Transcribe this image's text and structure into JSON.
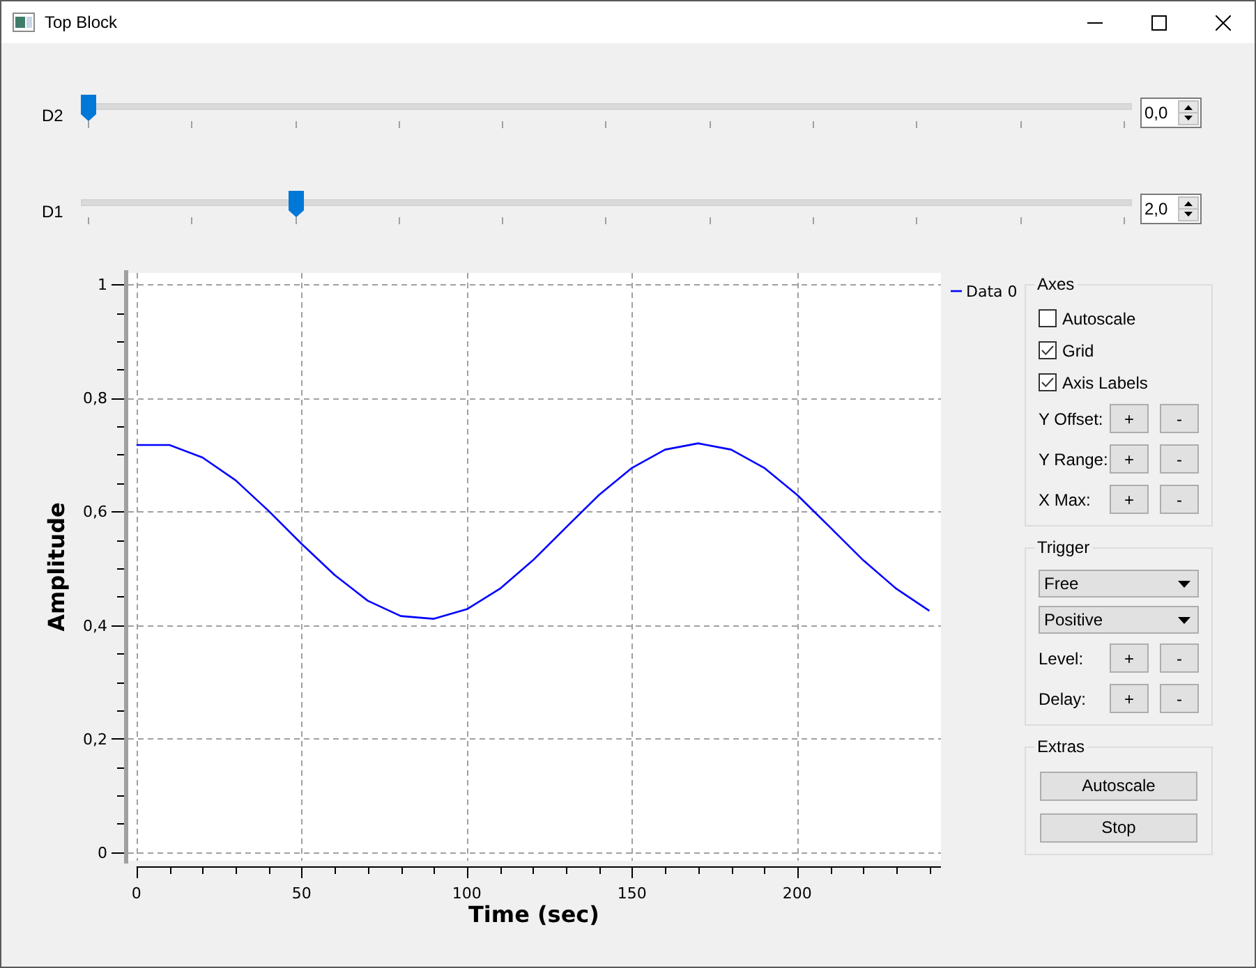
{
  "window": {
    "title": "Top Block"
  },
  "sliders": [
    {
      "label": "D2",
      "level": 0,
      "value": "0,0"
    },
    {
      "label": "D1",
      "level": 0.2,
      "value": "2,0"
    }
  ],
  "plot": {
    "chart_data": {
      "type": "line",
      "xlabel": "Time (sec)",
      "ylabel": "Amplitude",
      "x": [
        0,
        10,
        20,
        30,
        40,
        50,
        60,
        70,
        80,
        90,
        100,
        110,
        120,
        130,
        140,
        150,
        160,
        170,
        180,
        190,
        200,
        210,
        220,
        230,
        240
      ],
      "series": [
        {
          "name": "Data 0",
          "color": "#0000ff",
          "values": [
            0.717,
            0.717,
            0.695,
            0.655,
            0.601,
            0.543,
            0.488,
            0.443,
            0.416,
            0.411,
            0.428,
            0.464,
            0.514,
            0.572,
            0.629,
            0.677,
            0.709,
            0.72,
            0.709,
            0.677,
            0.629,
            0.572,
            0.514,
            0.464,
            0.425
          ]
        }
      ],
      "grid": true,
      "xlim": [
        -2.5,
        243.5
      ],
      "ylim": [
        -0.015,
        1.02
      ],
      "xticks": [
        0,
        50,
        100,
        150,
        200
      ],
      "yticks": [
        {
          "value": 0,
          "label": "0"
        },
        {
          "value": 0.2,
          "label": "0,2"
        },
        {
          "value": 0.4,
          "label": "0,4"
        },
        {
          "value": 0.6,
          "label": "0,6"
        },
        {
          "value": 0.8,
          "label": "0,8"
        },
        {
          "value": 1,
          "label": "1"
        }
      ]
    }
  },
  "groups": [
    {
      "title": "Axes",
      "rows": [
        {
          "kind": "checkbox",
          "label": "Autoscale",
          "checked": false
        },
        {
          "kind": "checkbox",
          "label": "Grid",
          "checked": true
        },
        {
          "kind": "checkbox",
          "label": "Axis Labels",
          "checked": true
        },
        {
          "kind": "stepper",
          "label": "Y Offset:",
          "buttons": [
            "+",
            "-"
          ]
        },
        {
          "kind": "stepper",
          "label": "Y Range:",
          "buttons": [
            "+",
            "-"
          ]
        },
        {
          "kind": "stepper",
          "label": "X Max:",
          "buttons": [
            "+",
            "-"
          ]
        }
      ]
    },
    {
      "title": "Trigger",
      "rows": [
        {
          "kind": "dropdown",
          "value": "Free"
        },
        {
          "kind": "dropdown",
          "value": "Positive"
        },
        {
          "kind": "stepper",
          "label": "Level:",
          "buttons": [
            "+",
            "-"
          ]
        },
        {
          "kind": "stepper",
          "label": "Delay:",
          "buttons": [
            "+",
            "-"
          ]
        }
      ]
    },
    {
      "title": "Extras",
      "rows": [
        {
          "kind": "button",
          "label": "Autoscale"
        },
        {
          "kind": "button",
          "label": "Stop"
        }
      ]
    }
  ]
}
